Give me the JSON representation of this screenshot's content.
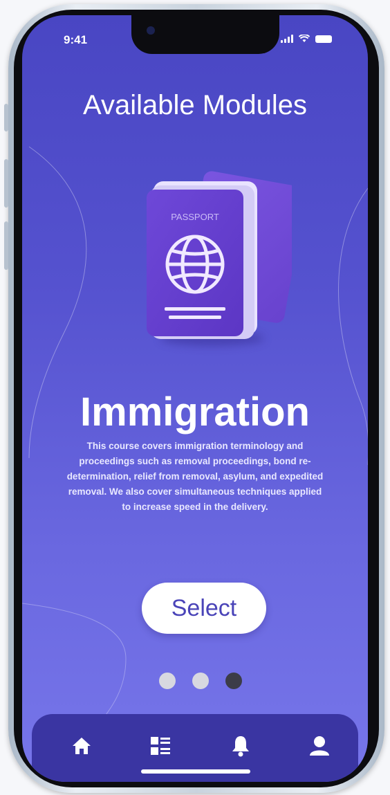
{
  "status_bar": {
    "time": "9:41"
  },
  "screen": {
    "title": "Available Modules",
    "illustration_label": "PASSPORT",
    "module_name": "Immigration",
    "description": "This course covers immigration terminology and proceedings such as removal proceedings, bond re-determination, relief from removal, asylum, and expedited removal. We also cover simultaneous techniques applied to increase speed in the delivery.",
    "select_label": "Select",
    "pagination": {
      "total": 3,
      "active_index": 2
    }
  },
  "tab_bar": {
    "items": [
      {
        "icon": "home-icon"
      },
      {
        "icon": "list-icon"
      },
      {
        "icon": "bell-icon"
      },
      {
        "icon": "profile-icon"
      }
    ]
  },
  "colors": {
    "background_top": "#4946c3",
    "background_bottom": "#7776ea",
    "tab_bar": "#3a35a2",
    "passport": "#6a3fd2",
    "button_text": "#4a44b8"
  }
}
